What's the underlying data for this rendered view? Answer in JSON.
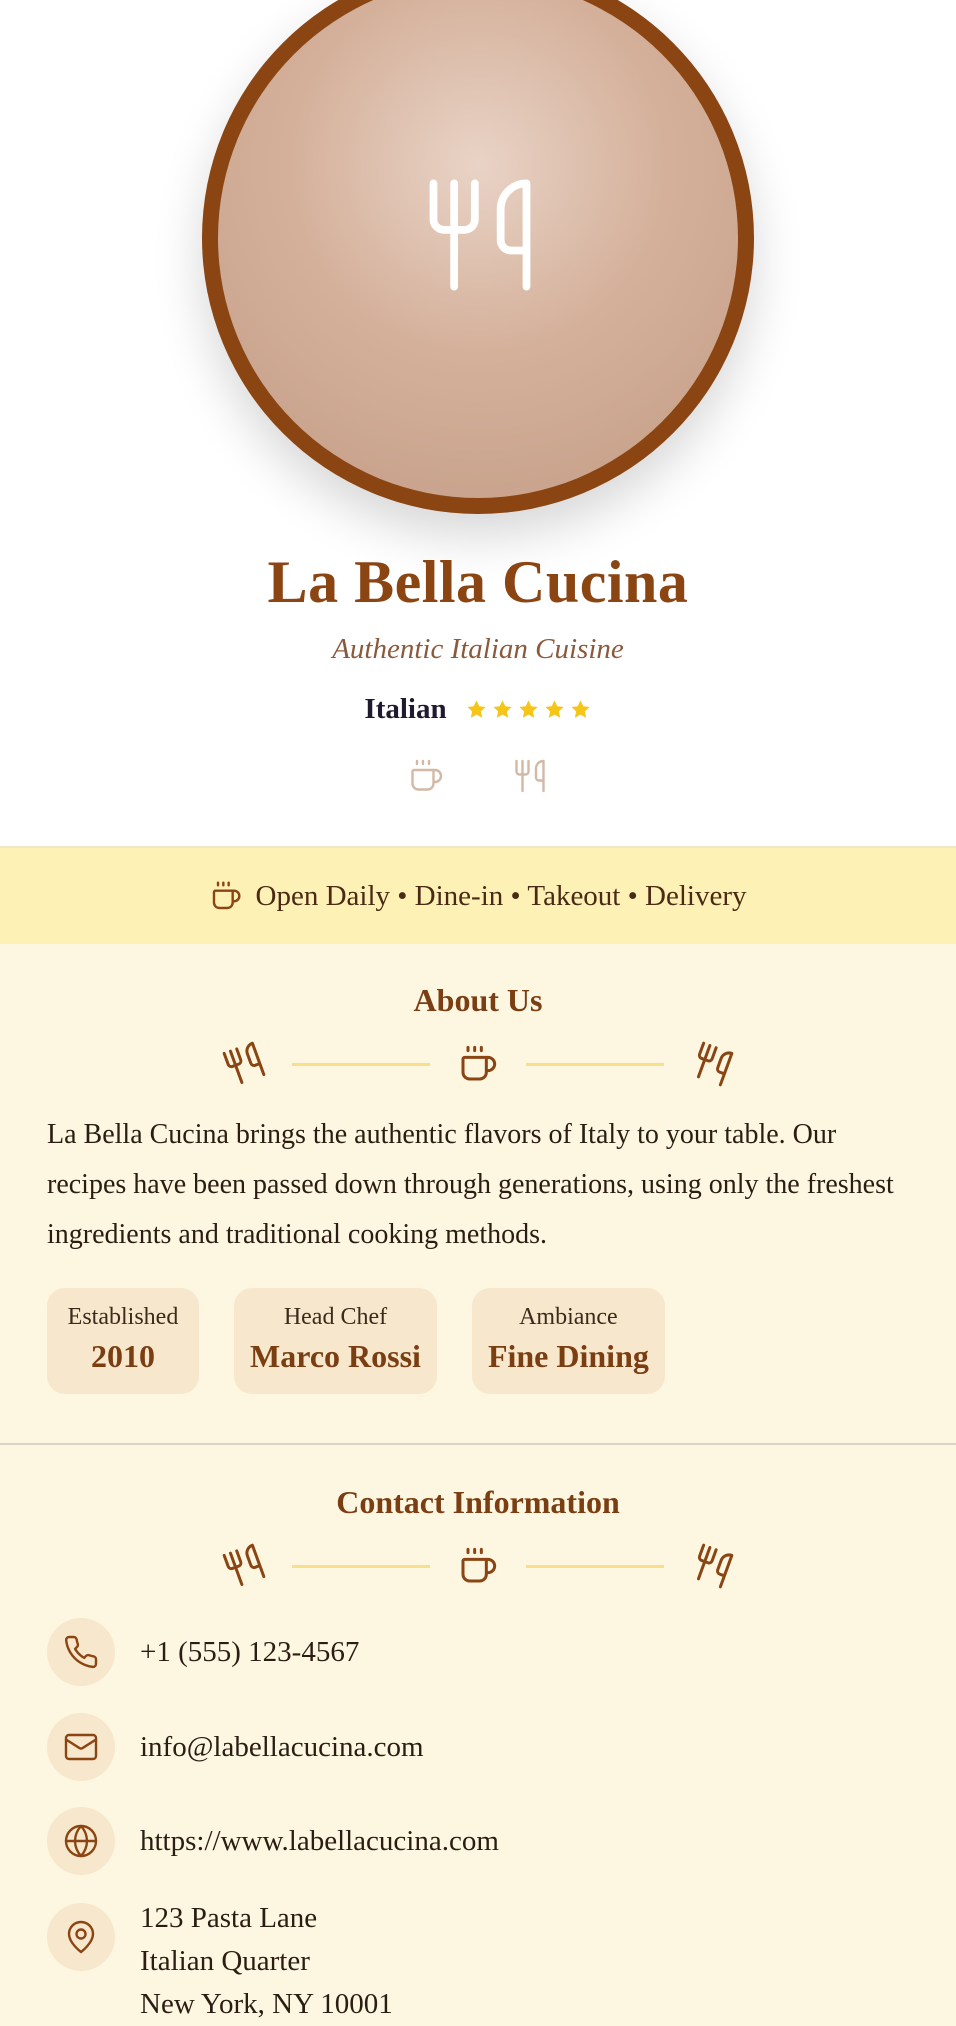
{
  "restaurant": {
    "name": "La Bella Cucina",
    "tagline": "Authentic Italian Cuisine",
    "cuisine": "Italian",
    "rating": 5
  },
  "banner": {
    "text": "Open Daily • Dine-in • Takeout • Delivery"
  },
  "about": {
    "title": "About Us",
    "description": "La Bella Cucina brings the authentic flavors of Italy to your table. Our recipes have been passed down through generations, using only the freshest ingredients and traditional cooking methods.",
    "cards": [
      {
        "label": "Established",
        "value": "2010"
      },
      {
        "label": "Head Chef",
        "value": "Marco Rossi"
      },
      {
        "label": "Ambiance",
        "value": "Fine Dining"
      }
    ]
  },
  "contact": {
    "title": "Contact Information",
    "phone": "+1 (555) 123-4567",
    "email": "info@labellacucina.com",
    "website": "https://www.labellacucina.com",
    "address": [
      "123 Pasta Lane",
      "Italian Quarter",
      "New York, NY 10001"
    ]
  },
  "colors": {
    "brand": "#8b4513",
    "star": "#f5c518",
    "banner_bg": "#fef1b5",
    "page_bg": "#fdf6e1",
    "divider_line": "#f8df8a"
  },
  "icons": {
    "logo": "utensils-icon",
    "hero_small": [
      "coffee-icon",
      "utensils-icon"
    ],
    "banner": "coffee-icon",
    "divider": [
      "utensils-icon",
      "coffee-icon",
      "utensils-icon"
    ],
    "contact": [
      "phone-icon",
      "mail-icon",
      "globe-icon",
      "map-pin-icon"
    ]
  }
}
